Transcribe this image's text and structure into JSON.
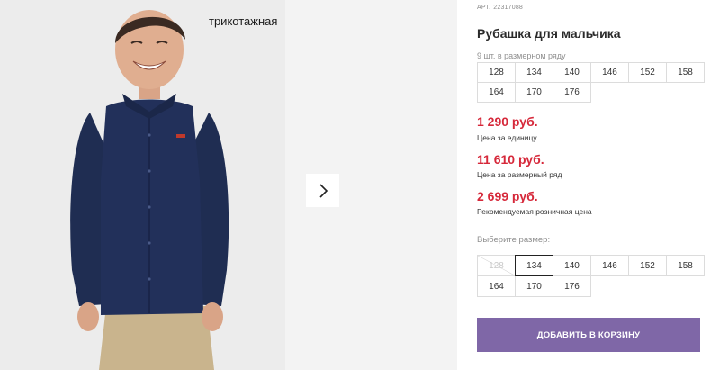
{
  "gallery": {
    "badge": "трикотажная",
    "next_icon": "chevron-right-icon"
  },
  "product": {
    "article_label": "АРТ.",
    "article_number": "22317088",
    "title": "Рубашка для мальчика",
    "size_range_note": "9 шт. в размерном ряду",
    "size_range": [
      "128",
      "134",
      "140",
      "146",
      "152",
      "158",
      "164",
      "170",
      "176"
    ]
  },
  "prices": {
    "unit_price": "1 290 руб.",
    "unit_caption": "Цена за единицу",
    "range_price": "11 610 руб.",
    "range_caption": "Цена за размерный ряд",
    "retail_price": "2 699 руб.",
    "retail_caption": "Рекомендуемая розничная цена",
    "price_color": "#d6283a"
  },
  "size_picker": {
    "label": "Выберите размер:",
    "sizes": [
      "128",
      "134",
      "140",
      "146",
      "152",
      "158",
      "164",
      "170",
      "176"
    ],
    "selected": "134",
    "unavailable": [
      "128"
    ]
  },
  "cart": {
    "button_label": "ДОБАВИТЬ В КОРЗИНУ",
    "button_color": "#7f67a7"
  }
}
